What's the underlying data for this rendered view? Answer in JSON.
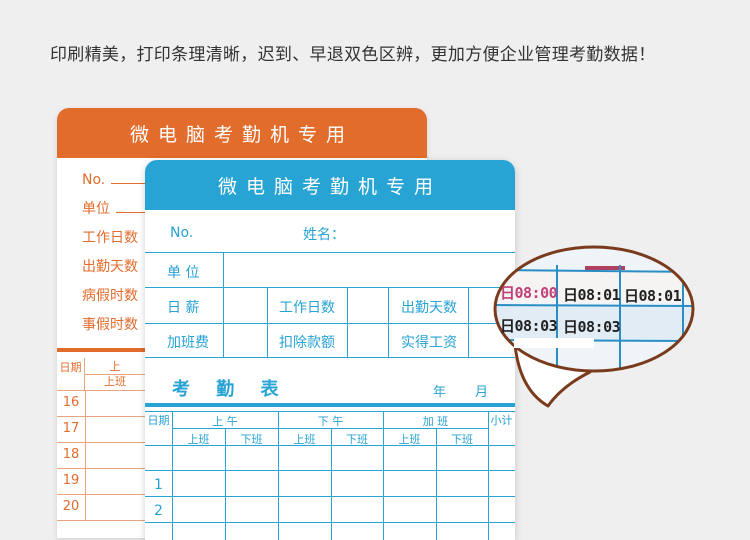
{
  "headline": "印刷精美，打印条理清晰，迟到、早退双色区辨，更加方便企业管理考勤数据！",
  "orange_card": {
    "title": "微电脑考勤机专用",
    "fields": [
      "No.",
      "单位",
      "工作日数",
      "出勤天数",
      "病假时数",
      "事假时数"
    ],
    "header_day": "日期",
    "header_morning": "上",
    "header_in": "上班",
    "rows": [
      "16",
      "17",
      "18",
      "19",
      "20"
    ]
  },
  "blue_card": {
    "title": "微电脑考勤机专用",
    "no_label": "No.",
    "name_label": "姓名：",
    "unit_label": "单  位",
    "salary_label": "日  薪",
    "workdays_label": "工作日数",
    "attendance_label": "出勤天数",
    "overtime_label": "加班费",
    "deduction_label": "扣除款额",
    "actual_label": "实得工资",
    "sheet_title": "考 勤 表",
    "year_label": "年",
    "month_label": "月",
    "header_day": "日期",
    "header_morning": "上  午",
    "header_afternoon": "下  午",
    "header_overtime": "加  班",
    "header_total": "小计",
    "header_in": "上班",
    "header_out": "下班",
    "rows": [
      "",
      "1",
      "2"
    ]
  },
  "zoom": {
    "row1": [
      "日08:00",
      "日08:01",
      "日08:01"
    ],
    "row2": [
      "日08:03",
      "日08:03"
    ],
    "late_color": "#c0407a",
    "normal_color": "#222222"
  },
  "colors": {
    "orange": "#e26c2c",
    "blue": "#27a3d4"
  }
}
